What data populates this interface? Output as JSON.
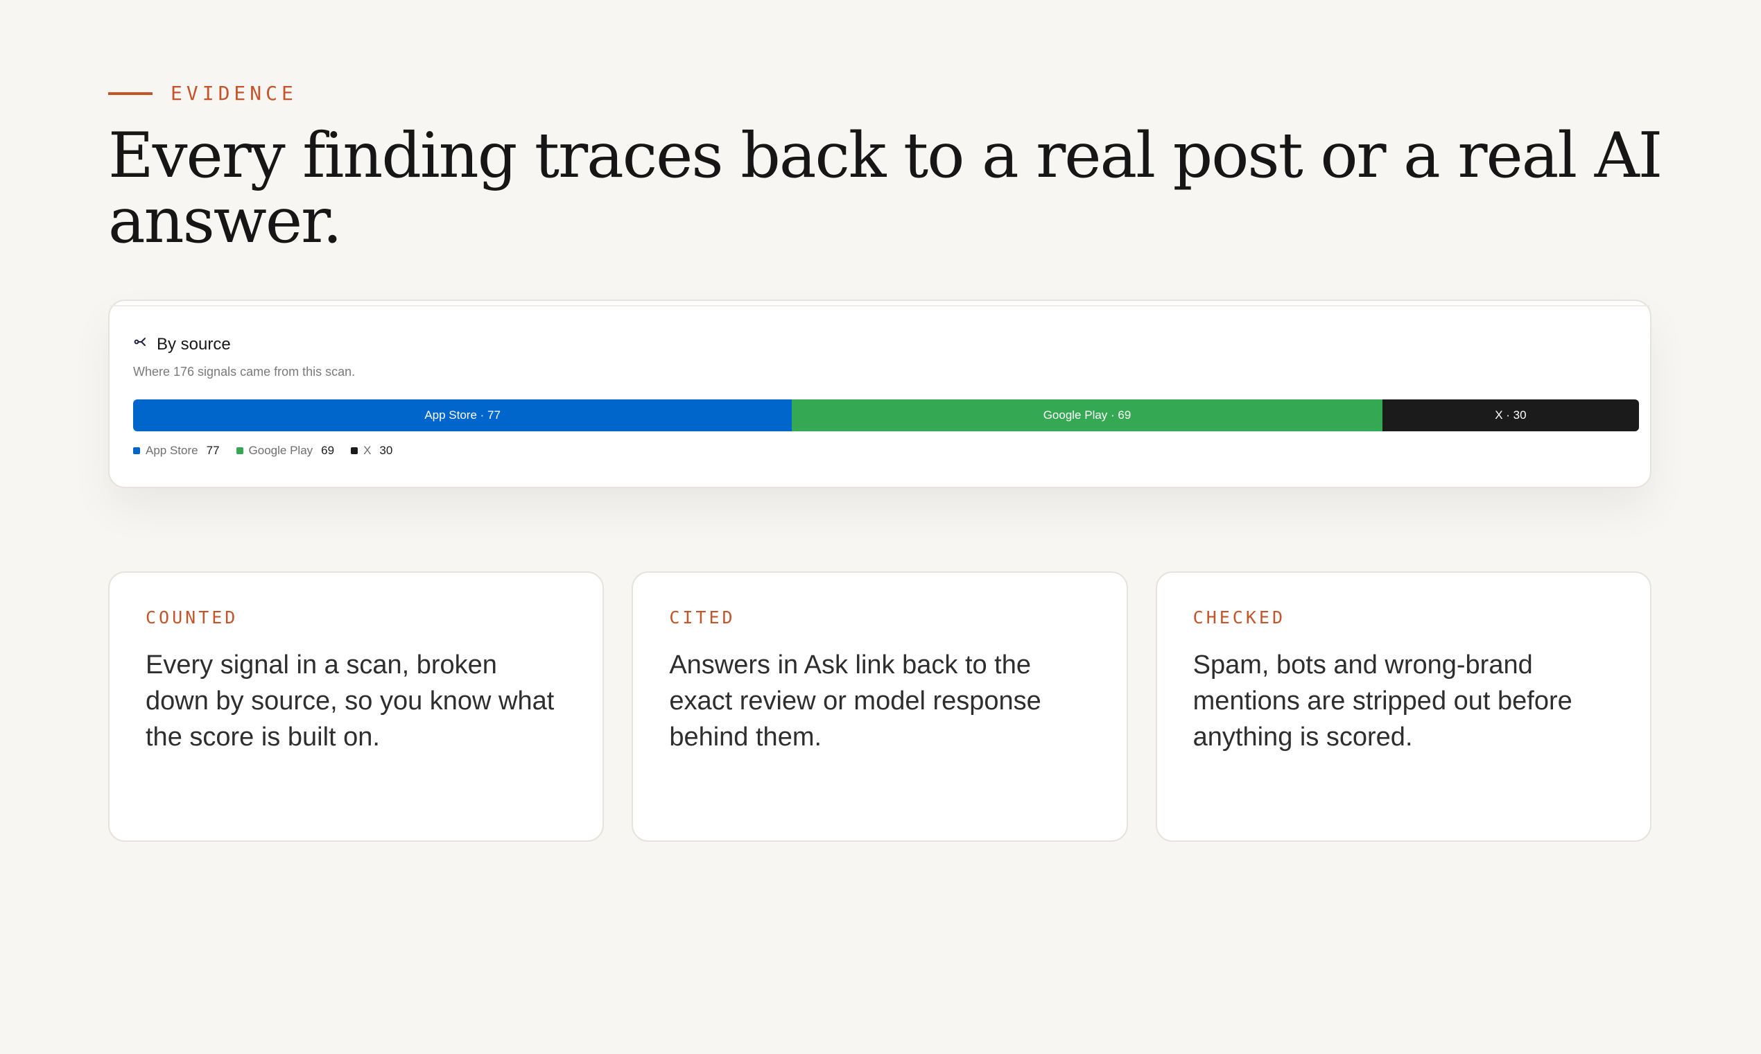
{
  "eyebrow": "EVIDENCE",
  "headline": "Every finding traces back to a real post or a real AI answer.",
  "panel": {
    "icon": "source-branch-icon",
    "title": "By source",
    "subtitle": "Where 176 signals came from this scan.",
    "segments": [
      {
        "label": "App Store · 77",
        "value": 77,
        "color": "#0066cc"
      },
      {
        "label": "Google Play · 69",
        "value": 69,
        "color": "#34a853"
      },
      {
        "label": "X · 30",
        "value": 30,
        "color": "#1b1b1b"
      }
    ],
    "legend": [
      {
        "name": "App Store",
        "value": "77",
        "color": "#0066cc"
      },
      {
        "name": "Google Play",
        "value": "69",
        "color": "#34a853"
      },
      {
        "name": "X",
        "value": "30",
        "color": "#1b1b1b"
      }
    ]
  },
  "cards": [
    {
      "label": "COUNTED",
      "body": "Every signal in a scan, broken down by source, so you know what the score is built on."
    },
    {
      "label": "CITED",
      "body": "Answers in Ask link back to the exact review or model response behind them."
    },
    {
      "label": "CHECKED",
      "body": "Spam, bots and wrong-brand mentions are stripped out before anything is scored."
    }
  ],
  "colors": {
    "accent": "#c4552a",
    "background": "#f7f6f2"
  }
}
